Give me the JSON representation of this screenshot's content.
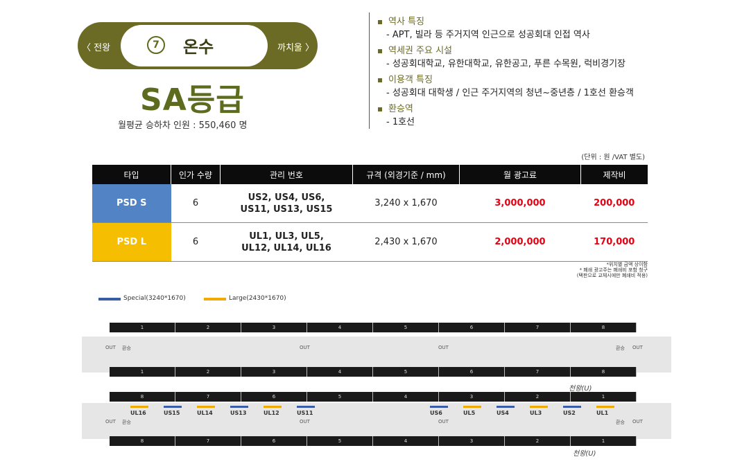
{
  "station": {
    "prev": "〈 전왕",
    "next": "까치울 〉",
    "number": "7",
    "name": "온수",
    "grade": "SA등급",
    "ridership": "월평균 승하차 인원 : 550,460 명"
  },
  "features": [
    {
      "heading": "역사 특징",
      "desc": "-  APT, 빌라 등 주거지역 인근으로 성공회대 인접 역사"
    },
    {
      "heading": "역세권 주요 시설",
      "desc": "-  성공회대학교, 유한대학교, 유한공고, 푸른 수목원, 럭비경기장"
    },
    {
      "heading": "이용객 특징",
      "desc": "-  성공회대 대학생 / 인근 주거지역의 청년~중년층 / 1호선 환승객"
    },
    {
      "heading": "환승역",
      "desc": "-  1호선"
    }
  ],
  "unit_note": "(단위 : 원 /VAT 별도)",
  "table": {
    "headers": [
      "타입",
      "인가 수량",
      "관리 번호",
      "규격 (외경기준 / mm)",
      "월 광고료",
      "제작비"
    ],
    "rows": [
      {
        "type": "PSD S",
        "qty": "6",
        "codes1": "US2, US4, US6,",
        "codes2": "US11, US13, US15",
        "size": "3,240 x 1,670",
        "fee": "3,000,000",
        "prod": "200,000"
      },
      {
        "type": "PSD L",
        "qty": "6",
        "codes1": "UL1, UL3, UL5,",
        "codes2": "UL12, UL14, UL16",
        "size": "2,430 x 1,670",
        "fee": "2,000,000",
        "prod": "170,000"
      }
    ]
  },
  "notes": [
    "*위치별 금액 상이함",
    "* 폐쇄 광고주는 폐쇄비 포함 청구",
    "(택판으로 교체시에만 폐쇄비 적용)"
  ],
  "legend": {
    "special": "Special(3240*1670)",
    "large": "Large(2430*1670)",
    "special_color": "#3a5ca8",
    "large_color": "#f2a900"
  },
  "diagram": {
    "doors_top": [
      "1",
      "2",
      "3",
      "4",
      "5",
      "6",
      "7",
      "8"
    ],
    "doors_bottom": [
      "8",
      "7",
      "6",
      "5",
      "4",
      "3",
      "2",
      "1"
    ],
    "out": "OUT",
    "transfer": "환승",
    "direction": "천왕(U)",
    "units_left": [
      "UL16",
      "US15",
      "UL14",
      "US13",
      "UL12",
      "US11"
    ],
    "units_right": [
      "US6",
      "UL5",
      "US4",
      "UL3",
      "US2",
      "UL1"
    ]
  }
}
